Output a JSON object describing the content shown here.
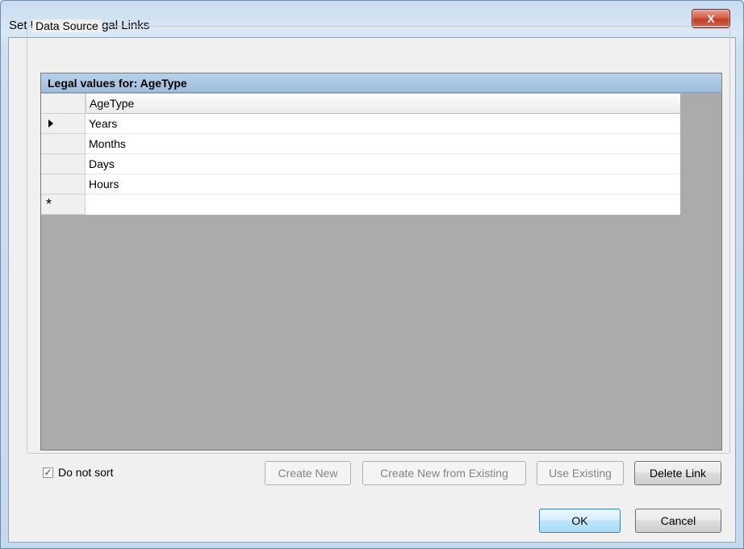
{
  "window": {
    "title": "Set Up Code / Legal Links",
    "close_glyph": "X"
  },
  "data_source": {
    "legend": "Data Source",
    "grid_caption": "Legal values for: AgeType",
    "column_header": "AgeType",
    "rows": [
      "Years",
      "Months",
      "Days",
      "Hours"
    ],
    "new_row_glyph": "*"
  },
  "options": {
    "do_not_sort_label": "Do not sort",
    "do_not_sort_checked": true
  },
  "buttons": {
    "create_new": "Create New",
    "create_new_from_existing": "Create New from Existing",
    "use_existing": "Use Existing",
    "delete_link": "Delete Link",
    "ok": "OK",
    "cancel": "Cancel"
  },
  "colors": {
    "grid_background": "#ababab",
    "caption_background": "#9fbddd",
    "default_button_border": "#3c7fb1"
  }
}
